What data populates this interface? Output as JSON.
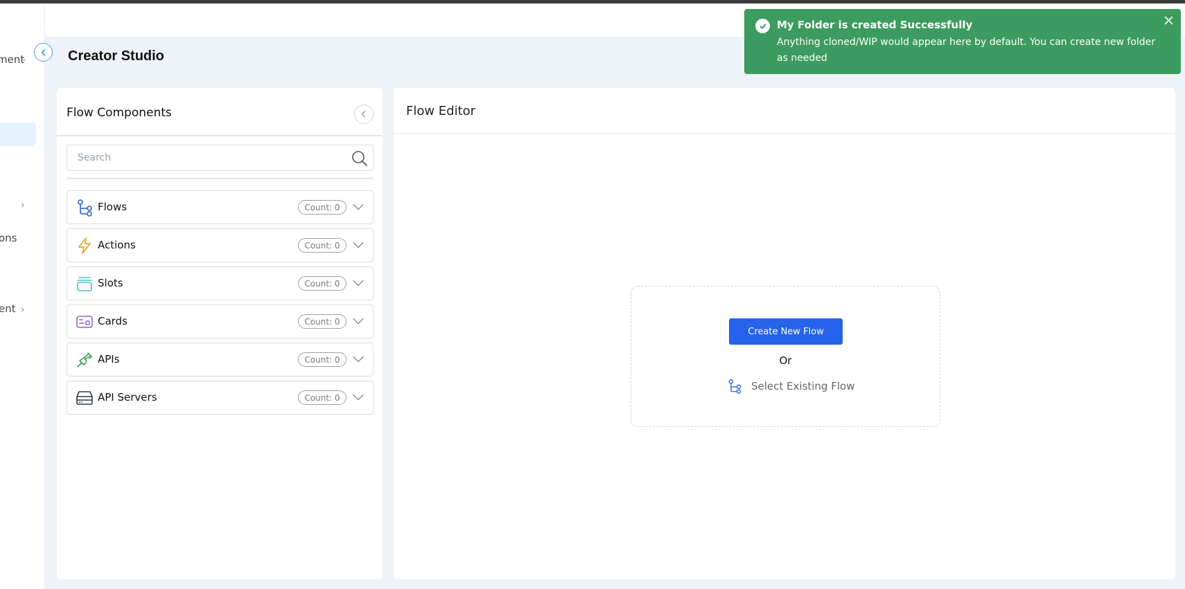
{
  "nav": {
    "item1_fragment": "ment",
    "item2_fragment": "ons",
    "item3_fragment": "ent"
  },
  "header": {
    "title": "Creator Studio"
  },
  "components_panel": {
    "title": "Flow Components",
    "search_placeholder": "Search",
    "items": [
      {
        "label": "Flows",
        "count": "Count: 0",
        "icon": "flow-icon",
        "color": "#3b6fd6"
      },
      {
        "label": "Actions",
        "count": "Count: 0",
        "icon": "lightning-icon",
        "color": "#e0a526"
      },
      {
        "label": "Slots",
        "count": "Count: 0",
        "icon": "slots-icon",
        "color": "#4cc0c8"
      },
      {
        "label": "Cards",
        "count": "Count: 0",
        "icon": "card-icon",
        "color": "#8a67c9"
      },
      {
        "label": "APIs",
        "count": "Count: 0",
        "icon": "plug-icon",
        "color": "#3b9a55"
      },
      {
        "label": "API Servers",
        "count": "Count: 0",
        "icon": "server-icon",
        "color": "#2e3a48"
      }
    ]
  },
  "editor": {
    "title": "Flow Editor",
    "create_button": "Create New Flow",
    "or": "Or",
    "select_existing": "Select Existing Flow"
  },
  "toast": {
    "title": "My Folder is created Successfully",
    "message": "Anything cloned/WIP would appear here by default. You can create new folder as needed",
    "color": "#3c9b5e"
  },
  "colors": {
    "accent": "#2563eb",
    "success": "#3c9b5e",
    "background": "#eef3fa"
  }
}
